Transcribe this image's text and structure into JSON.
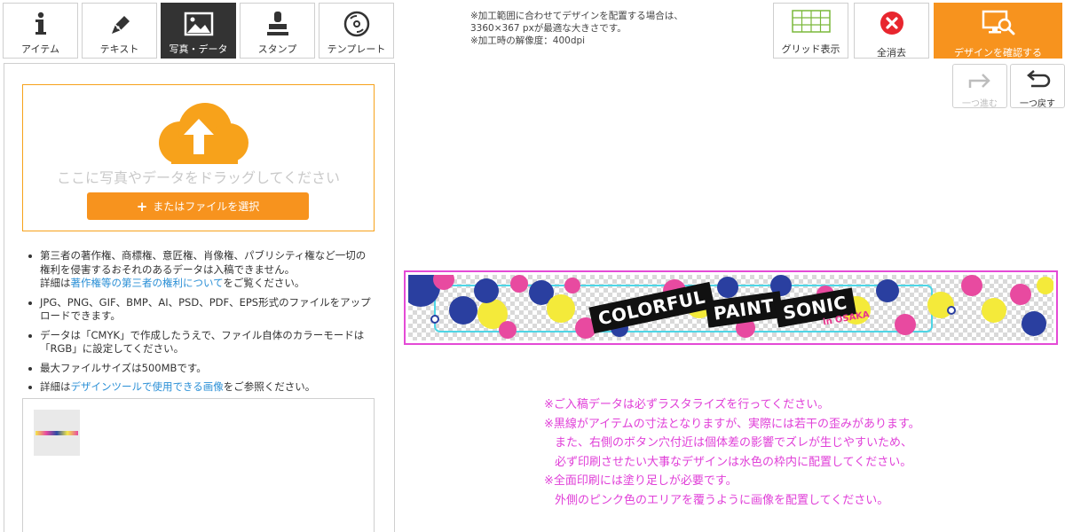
{
  "tabs": [
    {
      "label": "アイテム",
      "icon": "info-icon"
    },
    {
      "label": "テキスト",
      "icon": "pen-icon"
    },
    {
      "label": "写真・データ",
      "icon": "image-icon",
      "active": true
    },
    {
      "label": "スタンプ",
      "icon": "stamp-icon"
    },
    {
      "label": "テンプレート",
      "icon": "disc-icon"
    }
  ],
  "notice": {
    "line1": "※加工範囲に合わせてデザインを配置する場合は、",
    "line2": "3360×367 pxが最適な大きさです。",
    "line3": "※加工時の解像度：400dpi"
  },
  "toolbar": {
    "grid_label": "グリッド表示",
    "clear_label": "全消去",
    "confirm_label": "デザインを確認する",
    "redo_label": "一つ進む",
    "undo_label": "一つ戻す"
  },
  "upload": {
    "drop_text": "ここに写真やデータをドラッグしてください",
    "file_button": "またはファイルを選択"
  },
  "notes": {
    "n1_a": "第三者の著作権、商標権、意匠権、肖像権、パブリシティ権など一切の権利を侵害するおそれのあるデータは入稿できません。",
    "n1_b": "詳細は",
    "n1_link": "著作権等の第三者の権利について",
    "n1_c": "をご覧ください。",
    "n2": "JPG、PNG、GIF、BMP、AI、PSD、PDF、EPS形式のファイルをアップロードできます。",
    "n3": "データは「CMYK」で作成したうえで、ファイル自体のカラーモードは「RGB」に設定してください。",
    "n4": "最大ファイルサイズは500MBです。",
    "n5_a": "詳細は",
    "n5_link": "デザインツールで使用できる画像",
    "n5_b": "をご参照ください。"
  },
  "band": {
    "word1": "COLORFUL",
    "word2": "PAINT",
    "word3": "SONIC",
    "sub": "in OSAKA"
  },
  "pink_notes": {
    "l1": "※ご入稿データは必ずラスタライズを行ってください。",
    "l2": "※黒線がアイテムの寸法となりますが、実際には若干の歪みがあります。",
    "l3": "また、右側のボタン穴付近は個体差の影響でズレが生じやすいため、",
    "l4": "必ず印刷させたい大事なデザインは水色の枠内に配置してください。",
    "l5": "※全面印刷には塗り足しが必要です。",
    "l6": "外側のピンク色のエリアを覆うように画像を配置してください。"
  },
  "colors": {
    "accent": "#f7931e",
    "active_tab": "#333333",
    "pink_text": "#e040d8",
    "link": "#2a8fd6"
  }
}
